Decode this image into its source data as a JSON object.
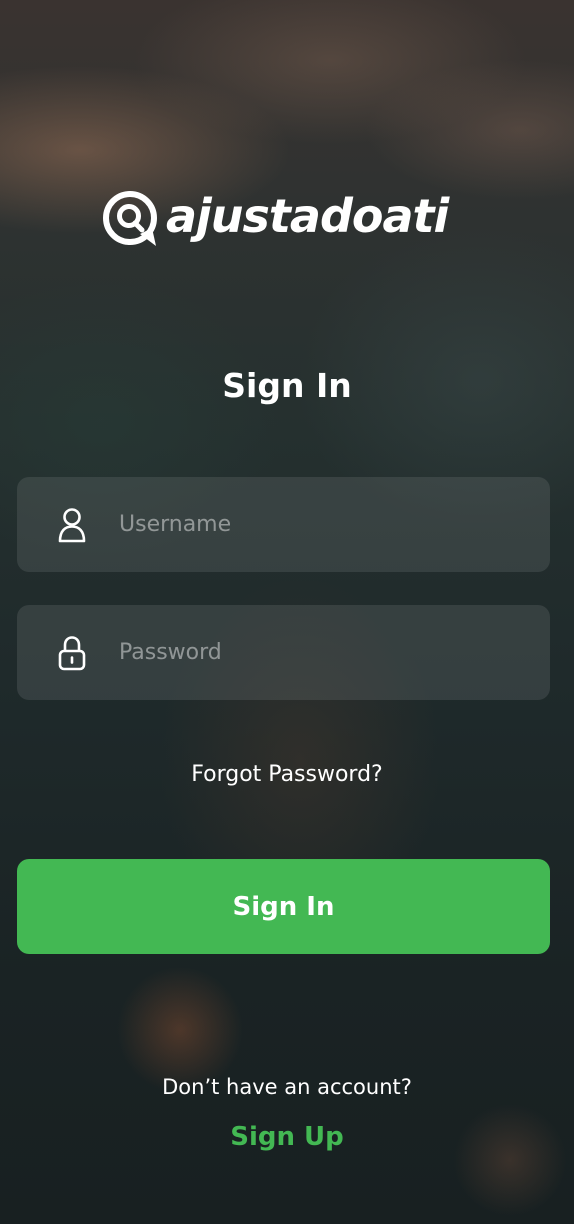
{
  "brand": {
    "name": "ajustadoati"
  },
  "signin": {
    "title": "Sign In",
    "username_placeholder": "Username",
    "password_placeholder": "Password",
    "forgot_password": "Forgot Password?",
    "button_label": "Sign In",
    "no_account_text": "Don’t have an account?",
    "signup_link": "Sign Up"
  },
  "icons": {
    "logo": "chat-bubble-search-icon",
    "username": "user-icon",
    "password": "lock-icon"
  },
  "colors": {
    "accent": "#43b853",
    "text": "#ffffff",
    "field_bg": "rgba(110,120,120,0.28)"
  }
}
